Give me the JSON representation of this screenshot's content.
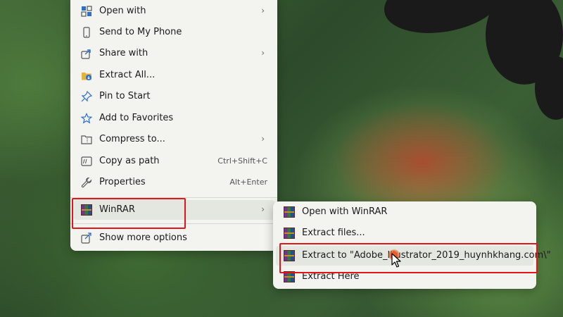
{
  "main_menu": {
    "items": [
      {
        "label": "Open with",
        "has_submenu": true,
        "icon": "open-with-icon"
      },
      {
        "label": "Send to My Phone",
        "icon": "phone-icon"
      },
      {
        "label": "Share with",
        "has_submenu": true,
        "icon": "share-icon"
      },
      {
        "label": "Extract All...",
        "icon": "extract-all-icon"
      },
      {
        "label": "Pin to Start",
        "icon": "pin-icon"
      },
      {
        "label": "Add to Favorites",
        "icon": "star-icon"
      },
      {
        "label": "Compress to...",
        "has_submenu": true,
        "icon": "folder-zip-icon"
      },
      {
        "label": "Copy as path",
        "shortcut": "Ctrl+Shift+C",
        "icon": "copy-path-icon"
      },
      {
        "label": "Properties",
        "shortcut": "Alt+Enter",
        "icon": "wrench-icon"
      }
    ],
    "winrar": {
      "label": "WinRAR",
      "has_submenu": true,
      "icon": "winrar-icon",
      "highlighted": true
    },
    "more": {
      "label": "Show more options",
      "icon": "more-options-icon"
    }
  },
  "submenu": {
    "items": [
      {
        "label": "Open with WinRAR",
        "icon": "winrar-icon"
      },
      {
        "label": "Extract files...",
        "icon": "winrar-icon"
      },
      {
        "label": "Extract to \"Adobe_Illustrator_2019_huynhkhang.com\\\"",
        "icon": "winrar-icon",
        "hovered": true
      },
      {
        "label": "Extract Here",
        "icon": "winrar-icon"
      }
    ]
  },
  "colors": {
    "accent": "#2a6fd1",
    "highlight_box": "#e0161b",
    "menu_bg": "#f3f4f0"
  }
}
